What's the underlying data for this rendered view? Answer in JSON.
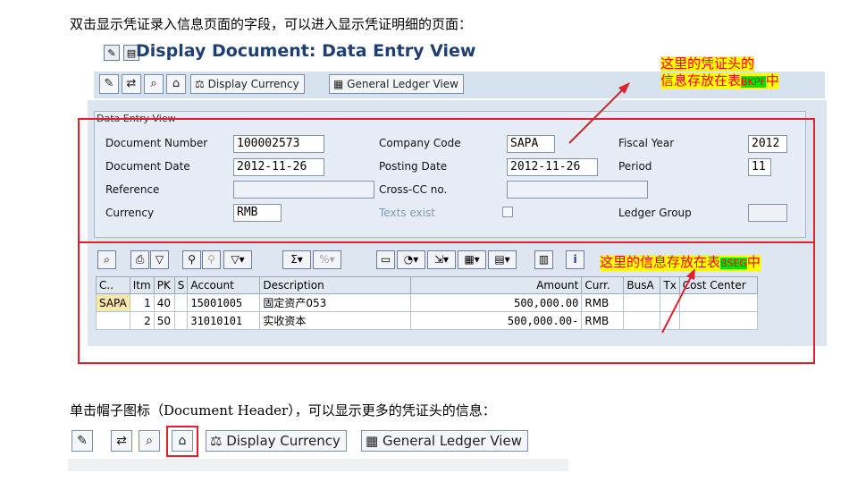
{
  "intro_top": "双击显示凭证录入信息页面的字段，可以进入显示凭证明细的页面：",
  "intro_bottom": "单击帽子图标（Document Header），可以显示更多的凭证头的信息：",
  "window": {
    "title": "Display Document: Data Entry View"
  },
  "toolbar": {
    "display_currency": "Display Currency",
    "general_ledger_view": "General Ledger View"
  },
  "header_section": {
    "tab": "Data Entry View",
    "document_number_label": "Document Number",
    "document_number": "100002573",
    "company_code_label": "Company Code",
    "company_code": "SAPA",
    "fiscal_year_label": "Fiscal Year",
    "fiscal_year": "2012",
    "document_date_label": "Document Date",
    "document_date": "2012-11-26",
    "posting_date_label": "Posting Date",
    "posting_date": "2012-11-26",
    "period_label": "Period",
    "period": "11",
    "reference_label": "Reference",
    "reference": "",
    "cross_cc_label": "Cross-CC no.",
    "cross_cc": "",
    "currency_label": "Currency",
    "currency": "RMB",
    "texts_exist_label": "Texts exist",
    "ledger_group_label": "Ledger Group",
    "ledger_group": ""
  },
  "line_items": {
    "columns": [
      "C..",
      "Itm",
      "PK",
      "S",
      "Account",
      "Description",
      "Amount",
      "Curr.",
      "BusA",
      "Tx",
      "Cost Center"
    ],
    "rows": [
      [
        "SAPA",
        "1",
        "40",
        "",
        "15001005",
        "固定资产053",
        "500,000.00",
        "RMB",
        "",
        "",
        ""
      ],
      [
        "",
        "2",
        "50",
        "",
        "31010101",
        "实收资本",
        "500,000.00-",
        "RMB",
        "",
        "",
        ""
      ]
    ]
  },
  "annotations": {
    "header_note_line1": "这里的凭证头的",
    "header_note_line2": "信息存放在表",
    "header_table": "BKPF",
    "header_suffix": "中",
    "items_note": "这里的信息存放在表",
    "items_table": "BSEG",
    "items_suffix": "中"
  },
  "bottom_toolbar": {
    "display_currency": "Display Currency",
    "general_ledger_view": "General Ledger View"
  },
  "colors": {
    "annotation_red": "#e0202a",
    "highlight_yellow": "#ffff00",
    "highlight_green": "#00e600",
    "sap_title": "#1f3e73"
  }
}
